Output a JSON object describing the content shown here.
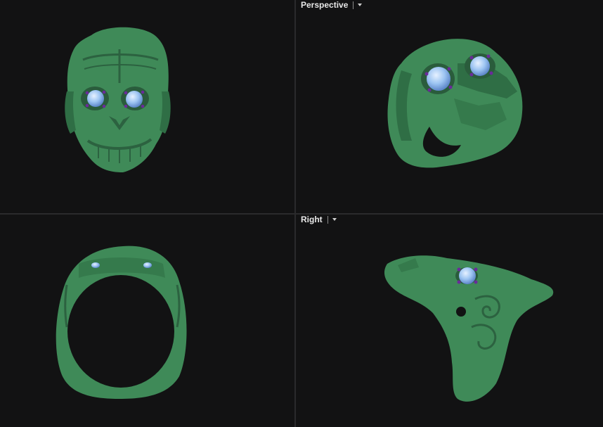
{
  "viewports": {
    "top_left": {
      "label": ""
    },
    "top_right": {
      "label": "Perspective",
      "menu_icon": "chevron-down-icon"
    },
    "bottom_left": {
      "label": ""
    },
    "bottom_right": {
      "label": "Right",
      "menu_icon": "chevron-down-icon"
    }
  },
  "colors": {
    "background": "#121213",
    "divider": "#2a2a2c",
    "model_green": "#3f8a58",
    "model_green_dark": "#2f6e45",
    "gem_blue": "#9cc4f2",
    "prong_purple": "#6a2a9a"
  }
}
